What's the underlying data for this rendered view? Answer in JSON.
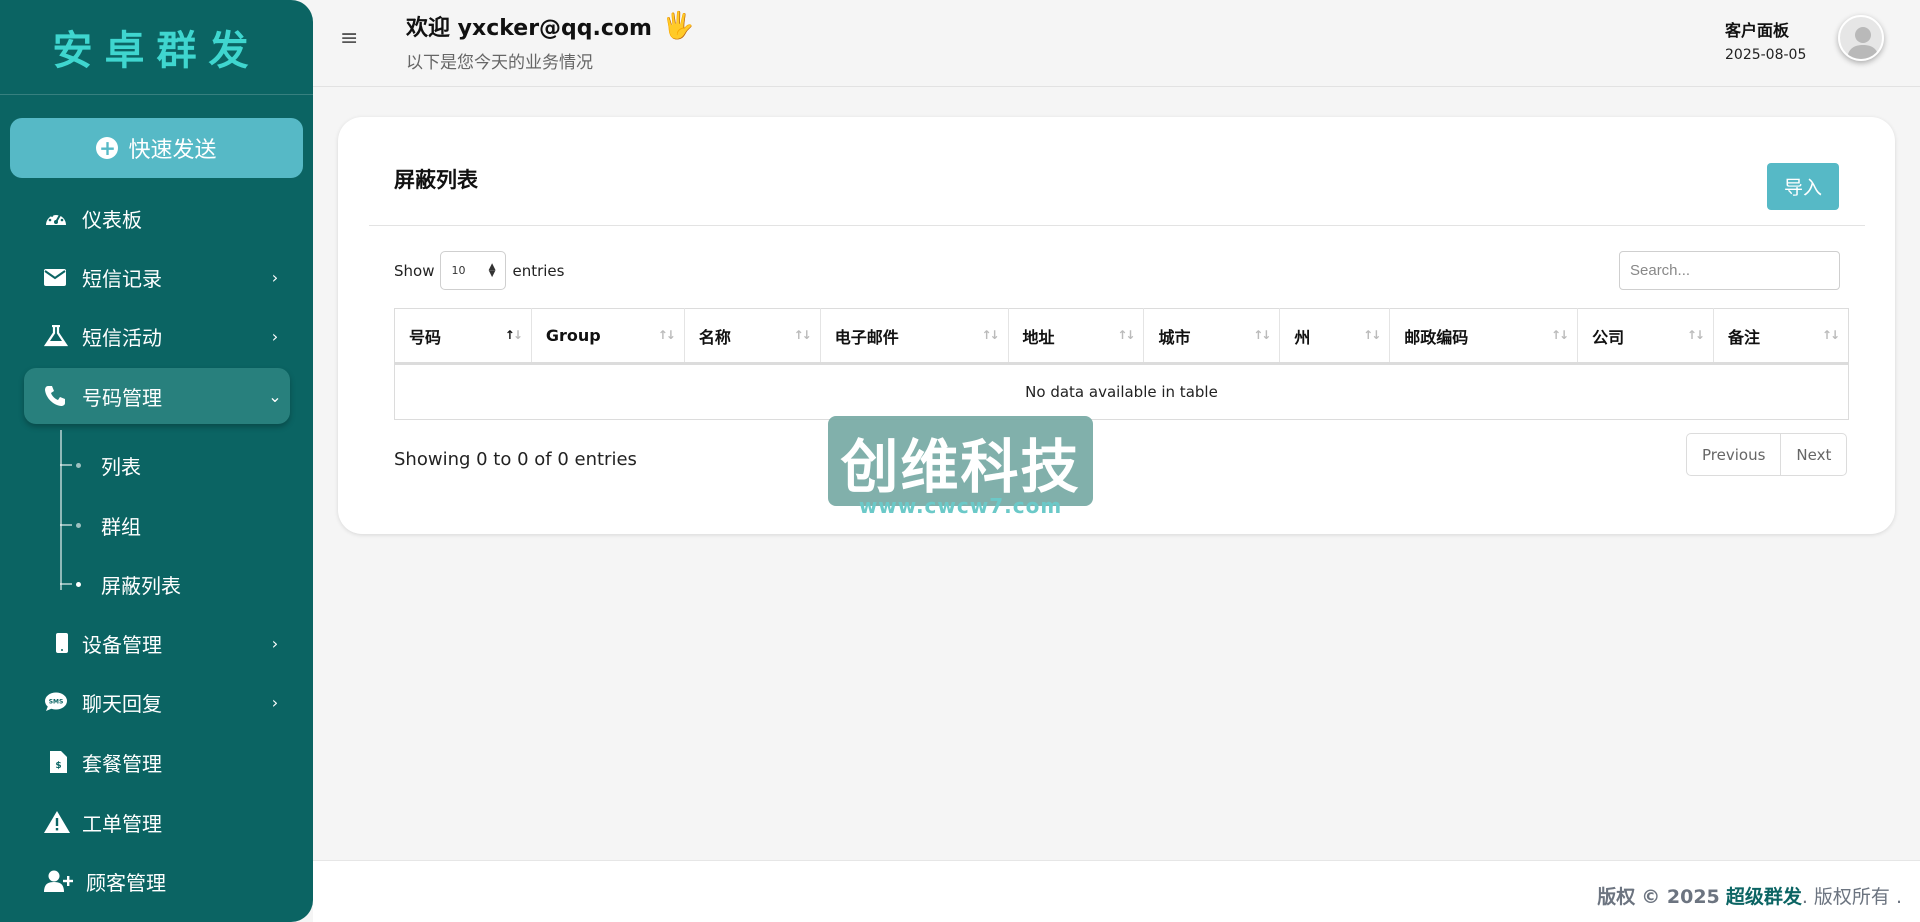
{
  "sidebar": {
    "brand": "安卓群发",
    "quick_send": "快速发送",
    "items": [
      {
        "label": "仪表板",
        "icon": "gauge-icon"
      },
      {
        "label": "短信记录",
        "icon": "envelope-icon",
        "chevron": "›"
      },
      {
        "label": "短信活动",
        "icon": "flask-icon",
        "chevron": "›"
      },
      {
        "label": "号码管理",
        "icon": "phone-icon",
        "chevron": "⌄"
      },
      {
        "label": "设备管理",
        "icon": "mobile-icon",
        "chevron": "›"
      },
      {
        "label": "聊天回复",
        "icon": "sms-bubble-icon",
        "chevron": "›"
      },
      {
        "label": "套餐管理",
        "icon": "invoice-icon"
      },
      {
        "label": "工单管理",
        "icon": "warning-icon"
      },
      {
        "label": "顾客管理",
        "icon": "user-plus-icon"
      }
    ],
    "sub_items": [
      "列表",
      "群组",
      "屏蔽列表"
    ]
  },
  "header": {
    "menu_icon": "≡",
    "welcome": "欢迎 yxcker@qq.com",
    "hand": "🖐",
    "subtitle": "以下是您今天的业务情况",
    "panel": "客户面板",
    "date": "2025-08-05"
  },
  "card": {
    "title": "屏蔽列表",
    "import_label": "导入",
    "show_label": "Show",
    "entries_label": "entries",
    "page_length": "10",
    "search_placeholder": "Search...",
    "columns": [
      "号码",
      "Group",
      "名称",
      "电子邮件",
      "地址",
      "城市",
      "州",
      "邮政编码",
      "公司",
      "备注"
    ],
    "empty_message": "No data available in table",
    "info": "Showing 0 to 0 of 0 entries",
    "prev_label": "Previous",
    "next_label": "Next"
  },
  "watermark": {
    "text": "创维科技",
    "url": "www.cwcw7.com"
  },
  "footer": {
    "prefix": "版权",
    "year": "© 2025",
    "brand": "超级群发",
    "suffix": ". 版权所有 ."
  },
  "colors": {
    "sidebar_bg": "#0b6463",
    "accent": "#56b9c6",
    "brand_text": "#3fd6cf"
  }
}
